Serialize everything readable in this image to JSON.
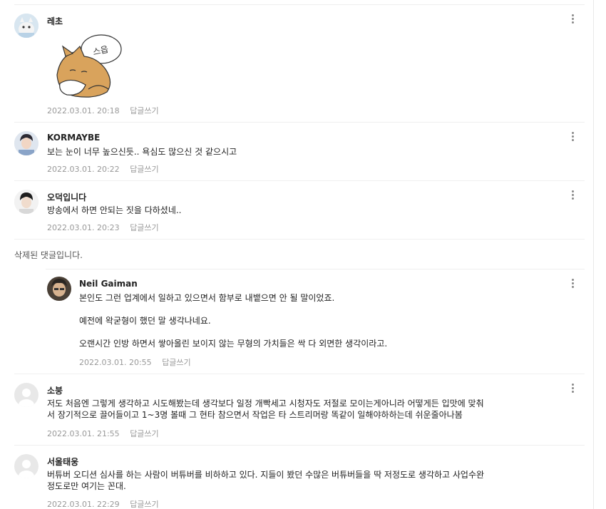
{
  "comments": [
    {
      "author": "레초",
      "lines": [],
      "sticker_text": "스읍",
      "date": "2022.03.01. 20:18",
      "reply": "답글쓰기"
    },
    {
      "author": "KORMAYBE",
      "lines": [
        "보는 눈이 너무 높으신듯.. 욕심도 많으신 것 같으시고"
      ],
      "date": "2022.03.01. 20:22",
      "reply": "답글쓰기"
    },
    {
      "author": "오덕입니다",
      "lines": [
        "방송에서 하면 안되는 짓을 다하셨네.."
      ],
      "date": "2022.03.01. 20:23",
      "reply": "답글쓰기"
    }
  ],
  "deleted_notice": "삭제된 댓글입니다.",
  "reply_comment": {
    "author": "Neil Gaiman",
    "paragraphs": [
      "본인도 그런 업계에서 일하고 있으면서 함부로 내뱉으면 안 될 말이었죠.",
      "예전에 왁굳형이 했던 말 생각나네요.",
      "오랜시간 인방 하면서 쌓아올린 보이지 않는 무형의 가치들은 싹 다 외면한 생각이라고."
    ],
    "date": "2022.03.01. 20:55",
    "reply": "답글쓰기"
  },
  "comments_after": [
    {
      "author": "소붕",
      "lines": [
        "저도 처음엔 그렇게 생각하고 시도해봤는데 생각보다 일정 개빡세고 시청자도 저절로 모이는게아니라 어떻게든 입맛에 맞춰",
        "서 장기적으로 끌어들이고 1~3명 볼때 그 현타 참으면서 작업은 타 스트리머랑 똑같이 일해야하하는데 쉬운줄아나봄"
      ],
      "date": "2022.03.01. 21:55",
      "reply": "답글쓰기"
    },
    {
      "author": "서울태웅",
      "lines": [
        "버튜버 오디션 심사를 하는 사람이 버튜버를 비하하고 있다. 지들이 봤던 수많은 버튜버들을 딱 저정도로 생각하고 사업수완",
        "정도로만 여기는 꼰대."
      ],
      "date": "2022.03.01. 22:29",
      "reply": "답글쓰기"
    }
  ]
}
